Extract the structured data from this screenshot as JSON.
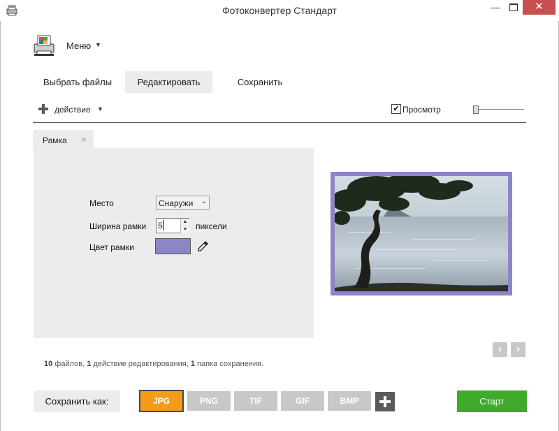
{
  "window": {
    "title": "Фотоконвертер Стандарт",
    "min_glyph": "—",
    "close_glyph": "✕"
  },
  "menu": {
    "label": "Меню",
    "arrow": "▼"
  },
  "tabs": [
    {
      "label": "Выбрать файлы",
      "active": false
    },
    {
      "label": "Редактировать",
      "active": true
    },
    {
      "label": "Сохранить",
      "active": false
    }
  ],
  "action_bar": {
    "add_action_label": "действие",
    "arrow": "▼",
    "preview_checked": true,
    "preview_check_glyph": "✔",
    "preview_label": "Просмотр",
    "zoom_fraction": 0.0
  },
  "edit_panel": {
    "tab_label": "Рамка",
    "tab_close": "×",
    "fields": {
      "place_label": "Место",
      "place_value": "Снаружи",
      "place_arrow": "⌄",
      "width_label": "Ширина рамки",
      "width_value": "5",
      "width_unit": "пиксели",
      "spin_up": "▲",
      "spin_down": "▼",
      "color_label": "Цвет рамки",
      "color_value": "#8c86c6"
    }
  },
  "preview": {
    "prev": "‹",
    "next": "›"
  },
  "status": {
    "files_count": "10",
    "files_text": " файлов, ",
    "actions_count": "1",
    "actions_text": " действие редактирования, ",
    "folders_count": "1",
    "folders_text": " папка сохранения."
  },
  "bottom": {
    "save_as_label": "Сохранить как:",
    "formats": [
      "JPG",
      "PNG",
      "TIF",
      "GIF",
      "BMP"
    ],
    "selected_format": "JPG",
    "start_label": "Старт"
  },
  "colors": {
    "accent_orange": "#f39c1a",
    "start_green": "#3faa2c",
    "close_red": "#c7504f",
    "frame_color": "#8c86c6"
  },
  "icons": {
    "app": "app-icon",
    "menu": "printer-menu-icon",
    "add": "plus-icon",
    "eyedropper": "eyedropper-icon",
    "format_add": "plus-icon"
  }
}
